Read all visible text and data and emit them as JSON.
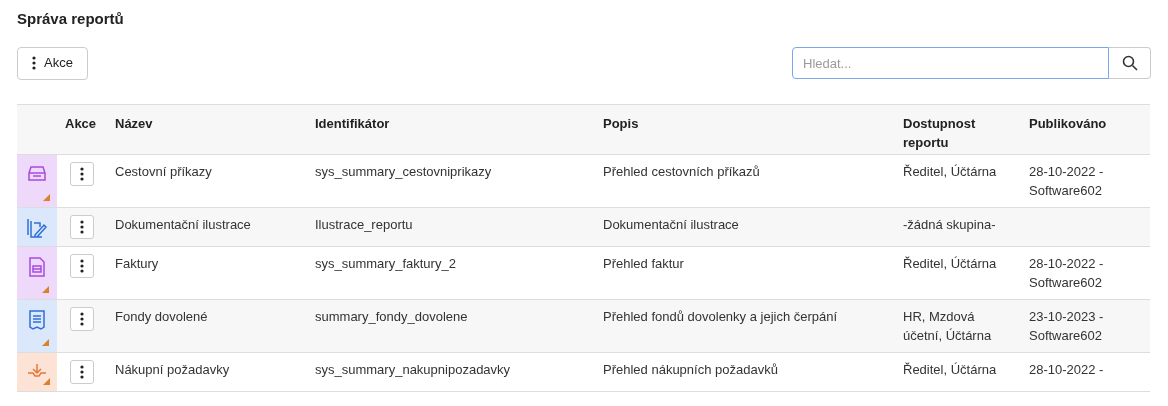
{
  "title": "Správa reportů",
  "actions_button": {
    "label": "Akce"
  },
  "search": {
    "placeholder": "Hledat..."
  },
  "table": {
    "columns": [
      "Akce",
      "Název",
      "Identifikátor",
      "Popis",
      "Dostupnost reportu",
      "Publikováno"
    ],
    "rows": [
      {
        "color": "#efd9fb",
        "marked": true,
        "name": "Cestovní příkazy",
        "identifier": "sys_summary_cestovniprikazy",
        "description": "Přehled cestovních příkazů",
        "availability": "Ředitel, Účtárna",
        "published": "28-10-2022 - Software602"
      },
      {
        "color": "#dbe8fb",
        "marked": false,
        "name": "Dokumentační ilustrace",
        "identifier": "Ilustrace_reportu",
        "description": "Dokumentační ilustrace",
        "availability": "-žádná skupina-",
        "published": ""
      },
      {
        "color": "#efd9fb",
        "marked": true,
        "name": "Faktury",
        "identifier": "sys_summary_faktury_2",
        "description": "Přehled faktur",
        "availability": "Ředitel, Účtárna",
        "published": "28-10-2022 - Software602"
      },
      {
        "color": "#dbe8fb",
        "marked": true,
        "name": "Fondy dovolené",
        "identifier": "summary_fondy_dovolene",
        "description": "Přehled fondů dovolenky a jejich čerpání",
        "availability": "HR, Mzdová účetní, Účtárna",
        "published": "23-10-2023 - Software602"
      },
      {
        "color": "#fde3d6",
        "marked": true,
        "name": "Nákupní požadavky",
        "identifier": "sys_summary_nakupnipozadavky",
        "description": "Přehled nákupních požadavků",
        "availability": "Ředitel, Účtárna",
        "published": "28-10-2022 -"
      }
    ]
  }
}
